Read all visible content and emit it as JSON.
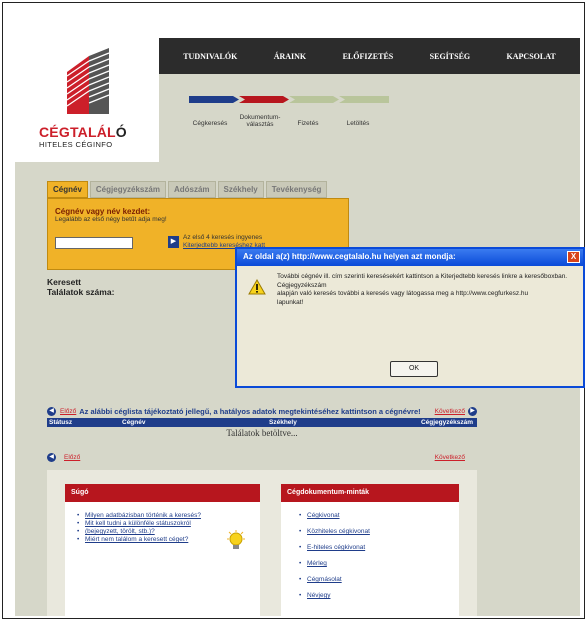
{
  "brand": {
    "name_red": "CÉGTALÁL",
    "name_dark": "Ó",
    "tagline": "HITELES CÉGINFO"
  },
  "nav": [
    "TUDNIVALÓK",
    "ÁRAINK",
    "ELŐFIZETÉS",
    "SEGÍTSÉG",
    "KAPCSOLAT"
  ],
  "steps": [
    {
      "label": "Cégkeresés",
      "color": "#1f3d8a"
    },
    {
      "label": "Dokumentum-\nválasztás",
      "color": "#b7161e"
    },
    {
      "label": "Fizetés",
      "color": "#b9c59b"
    },
    {
      "label": "Letöltés",
      "color": "#b9c59b"
    }
  ],
  "search": {
    "tabs": [
      "Cégnév",
      "Cégjegyzékszám",
      "Adószám",
      "Székhely",
      "Tevékenység"
    ],
    "title": "Cégnév vagy név kezdet:",
    "hint": "Legalább az első négy betűt adja meg!",
    "free_note": "Az első 4 keresés ingyenes",
    "advanced_link": "Kiterjedtebb kereséshez katt"
  },
  "results": {
    "label": "Keresett",
    "count_label": "Találatok száma:",
    "prev": "Előző",
    "next": "Következő",
    "info": "Az alábbi céglista tájékoztató jellegű, a hatályos adatok megtekintéséhez kattintson a cégnévre!",
    "columns": [
      "Státusz",
      "Cégnév",
      "Székhely",
      "Cégjegyzékszám"
    ],
    "loading": "Találatok betöltve..."
  },
  "help": {
    "title": "Súgó",
    "items": [
      "Milyen adatbázisban történik a keresés?",
      "Mit kell tudni a különféle státuszokról",
      "(bejegyzett, törölt, stb.)?",
      "Miért nem találom a keresett céget?"
    ]
  },
  "docs": {
    "title": "Cégdokumentum-minták",
    "items": [
      "Cégkivonat",
      "Közhiteles cégkivonat",
      "E-hiteles cégkivonat",
      "Mérleg",
      "Cégmásolat",
      "Névjegy"
    ]
  },
  "dialog": {
    "title": "Az oldal a(z) http://www.cegtalalo.hu helyen azt mondja:",
    "message_lines": [
      "További cégnév ill. cím szerinti keresésekért kattintson a Kiterjedtebb keresés linkre a keresőboxban.",
      "Cégjegyzékszám",
      "alapján való keresés további a keresés vagy látogassa meg a http://www.cegfurkesz.hu",
      "lapunkat!"
    ],
    "ok_label": "OK",
    "close_label": "X"
  },
  "colors": {
    "nav_bg": "#2c2c2c",
    "accent_blue": "#1f3d8a",
    "accent_red": "#b7161e",
    "search_orange": "#f0b228",
    "page_bg": "#d6d7c9"
  }
}
